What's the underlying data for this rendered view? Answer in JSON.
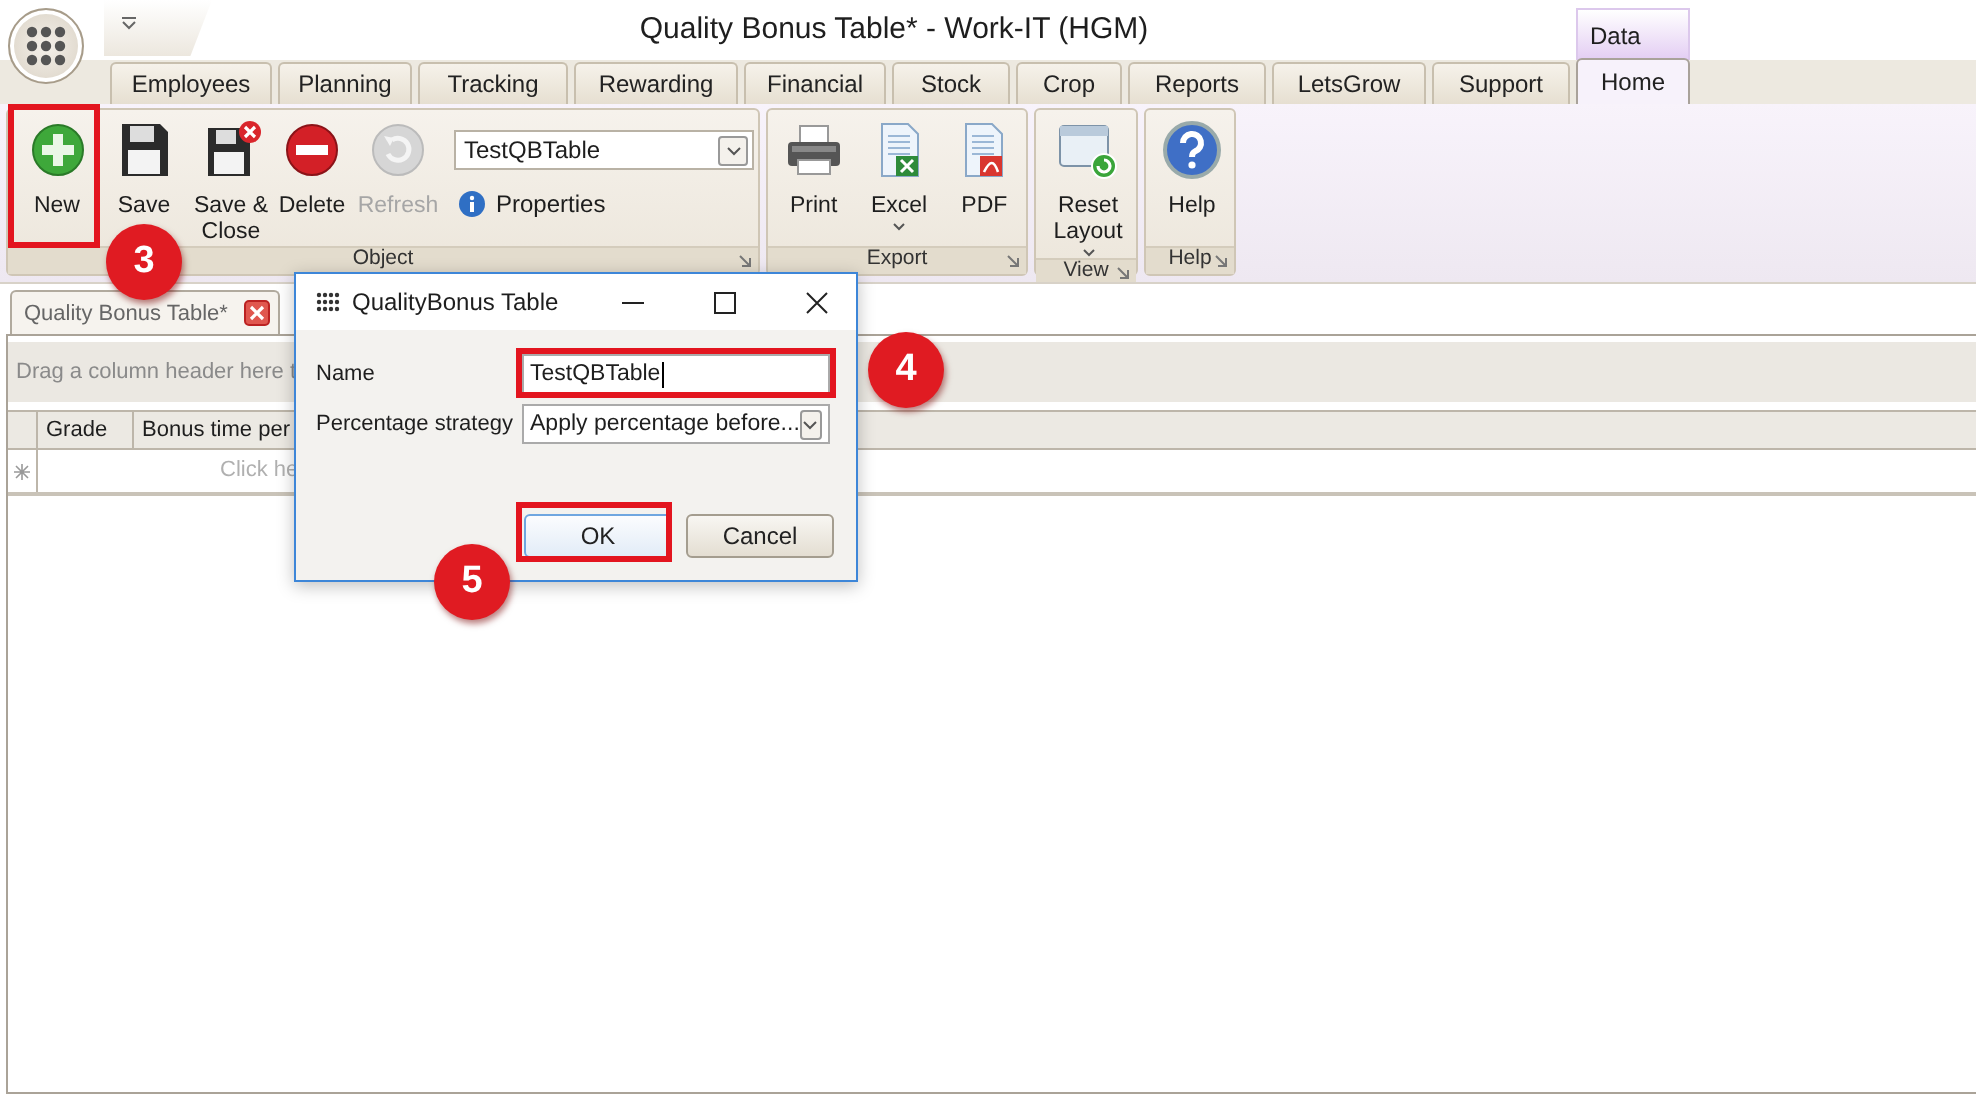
{
  "window": {
    "title": "Quality Bonus Table* - Work-IT (HGM)"
  },
  "contextual_tab": {
    "label": "Data"
  },
  "tabs": [
    {
      "label": "Employees",
      "selected": false
    },
    {
      "label": "Planning",
      "selected": false
    },
    {
      "label": "Tracking",
      "selected": false
    },
    {
      "label": "Rewarding",
      "selected": false
    },
    {
      "label": "Financial",
      "selected": false
    },
    {
      "label": "Stock",
      "selected": false
    },
    {
      "label": "Crop",
      "selected": false
    },
    {
      "label": "Reports",
      "selected": false
    },
    {
      "label": "LetsGrow",
      "selected": false
    },
    {
      "label": "Support",
      "selected": false
    },
    {
      "label": "Home",
      "selected": true
    }
  ],
  "ribbon": {
    "groups": [
      {
        "label": "Object",
        "items": [
          {
            "kind": "button",
            "label": "New",
            "disabled": false,
            "has_menu": false
          },
          {
            "kind": "button",
            "label": "Save",
            "disabled": false,
            "has_menu": false
          },
          {
            "kind": "button",
            "label": "Save & Close",
            "disabled": false,
            "has_menu": false
          },
          {
            "kind": "button",
            "label": "Delete",
            "disabled": false,
            "has_menu": false
          },
          {
            "kind": "button",
            "label": "Refresh",
            "disabled": true,
            "has_menu": false
          },
          {
            "kind": "combo",
            "value": "TestQBTable"
          },
          {
            "kind": "link",
            "label": "Properties"
          }
        ]
      },
      {
        "label": "Export",
        "items": [
          {
            "kind": "button",
            "label": "Print",
            "disabled": false,
            "has_menu": false
          },
          {
            "kind": "button",
            "label": "Excel",
            "disabled": false,
            "has_menu": true
          },
          {
            "kind": "button",
            "label": "PDF",
            "disabled": false,
            "has_menu": false
          }
        ]
      },
      {
        "label": "View",
        "items": [
          {
            "kind": "button",
            "label": "Reset Layout",
            "disabled": false,
            "has_menu": true
          }
        ]
      },
      {
        "label": "Help",
        "items": [
          {
            "kind": "button",
            "label": "Help",
            "disabled": false,
            "has_menu": false
          }
        ]
      }
    ]
  },
  "document_tabs": [
    {
      "label": "Quality Bonus Table*",
      "selected": true
    }
  ],
  "grid": {
    "group_panel_hint": "Drag a column header here t",
    "columns": [
      "Grade",
      "Bonus time per"
    ],
    "new_row_hint": "Click he"
  },
  "dialog": {
    "title": "QualityBonus Table",
    "fields": [
      {
        "kind": "text",
        "label": "Name",
        "value": "TestQBTable",
        "focused": true
      },
      {
        "kind": "dropdown",
        "label": "Percentage strategy",
        "value": "Apply percentage before...",
        "focused": false
      }
    ],
    "buttons": [
      {
        "label": "OK",
        "focused": true
      },
      {
        "label": "Cancel",
        "focused": false
      }
    ]
  },
  "annotations": [
    {
      "number": "3"
    },
    {
      "number": "4"
    },
    {
      "number": "5"
    }
  ]
}
